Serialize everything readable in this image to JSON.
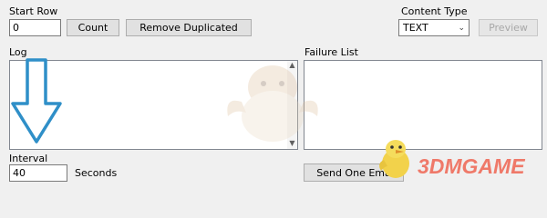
{
  "start_row": {
    "label": "Start Row",
    "value": "0"
  },
  "buttons": {
    "count": "Count",
    "remove_duplicated": "Remove Duplicated",
    "right_disabled": "Preview",
    "send_one": "Send One Ema"
  },
  "content_type": {
    "label": "Content Type",
    "selected": "TEXT"
  },
  "log": {
    "label": "Log"
  },
  "failure_list": {
    "label": "Failure List"
  },
  "interval": {
    "label": "Interval",
    "value": "40",
    "unit": "Seconds"
  },
  "watermark": {
    "text": "3DMGAME"
  },
  "colors": {
    "arrow": "#2f8fc8",
    "watermark": "#ef6d5b"
  }
}
